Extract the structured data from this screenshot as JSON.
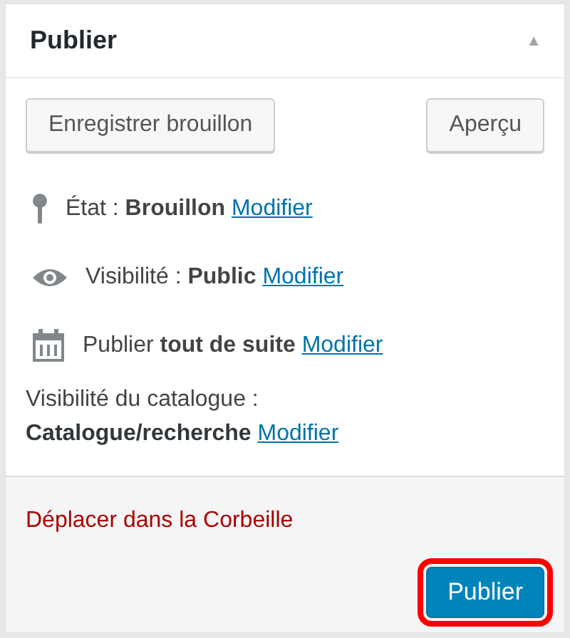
{
  "panel": {
    "title": "Publier",
    "collapse_icon": "▲"
  },
  "actions": [
    {
      "label": "Enregistrer brouillon"
    },
    {
      "label": "Aperçu"
    }
  ],
  "rows": [
    {
      "kind": "status",
      "text": "État : **Brouillon**",
      "link": "Modifier"
    },
    {
      "kind": "visibility",
      "text": "Visibilité : **Public**",
      "link": "Modifier"
    },
    {
      "kind": "schedule",
      "text": "Publier **tout de suite**",
      "link": "Modifier"
    },
    {
      "kind": "catalog",
      "text": "Visibilité du catalogue :",
      "value": "Catalogue/recherche",
      "link": "Modifier"
    }
  ],
  "footer": {
    "trash_link": "Déplacer dans la Corbeille",
    "publish_button": {
      "label": "Publier",
      "highlighted": true
    }
  }
}
